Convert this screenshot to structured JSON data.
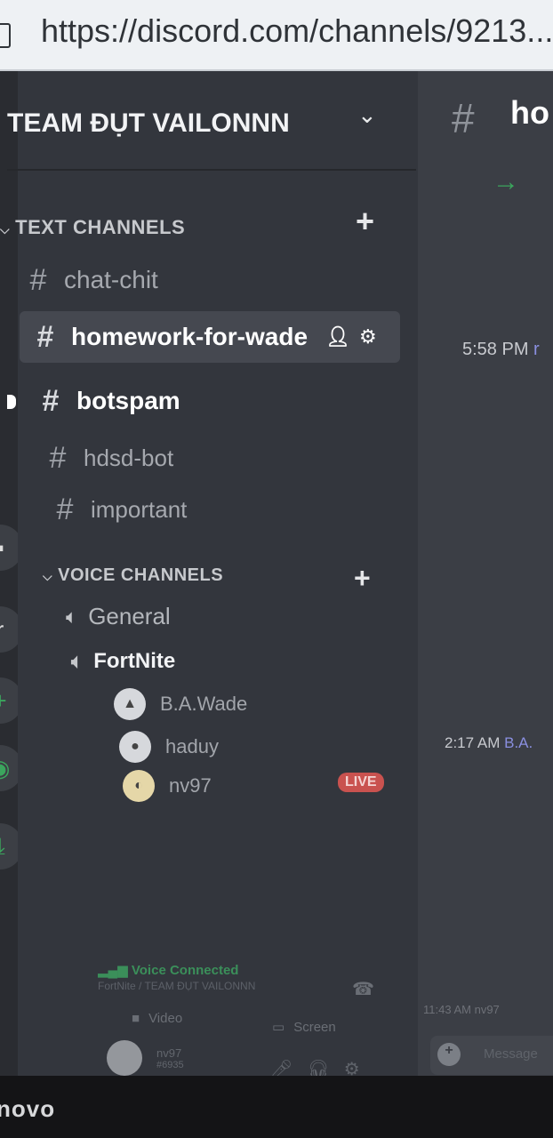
{
  "browser": {
    "url": "https://discord.com/channels/9213...",
    "page_icon": "page-icon"
  },
  "server": {
    "name": "TEAM ĐỤT VAILONNN",
    "menu_icon": "chevron-down-icon"
  },
  "text_channels": {
    "category_label": "TEXT CHANNELS",
    "add_icon": "plus-icon",
    "items": [
      {
        "name": "chat-chit",
        "icon": "hash-icon",
        "state": "normal"
      },
      {
        "name": "homework-for-wade",
        "icon": "hash-icon",
        "state": "selected"
      },
      {
        "name": "botspam",
        "icon": "hash-icon",
        "state": "unread"
      },
      {
        "name": "hdsd-bot",
        "icon": "locked-hash-icon",
        "state": "normal"
      },
      {
        "name": "important",
        "icon": "locked-hash-icon",
        "state": "normal"
      }
    ]
  },
  "voice_channels": {
    "category_label": "VOICE CHANNELS",
    "add_icon": "plus-icon",
    "items": [
      {
        "name": "General",
        "icon": "speaker-icon"
      },
      {
        "name": "FortNite",
        "icon": "speaker-icon"
      }
    ],
    "users": [
      {
        "name": "B.A.Wade",
        "badge": "LIVE"
      },
      {
        "name": "haduy"
      },
      {
        "name": "nv97"
      }
    ]
  },
  "voice_panel": {
    "status": "Voice Connected",
    "location": "FortNite / TEAM ĐỤT VAILONNN",
    "video_label": "Video",
    "screen_label": "Screen",
    "username": "nv97",
    "tag": "#6935"
  },
  "chat": {
    "channel_title": "ho",
    "messages": [
      {
        "time": "5:58 PM",
        "author": "r"
      },
      {
        "time": "2:17 AM",
        "author": "B.A."
      },
      {
        "time": "11:43 AM",
        "author": "nv97"
      }
    ],
    "input_placeholder": "Message"
  },
  "colors": {
    "accent_green": "#3ba55d",
    "live_red": "#c9524f",
    "username_blue": "#8a8fe0"
  },
  "monitor_brand": "novo"
}
